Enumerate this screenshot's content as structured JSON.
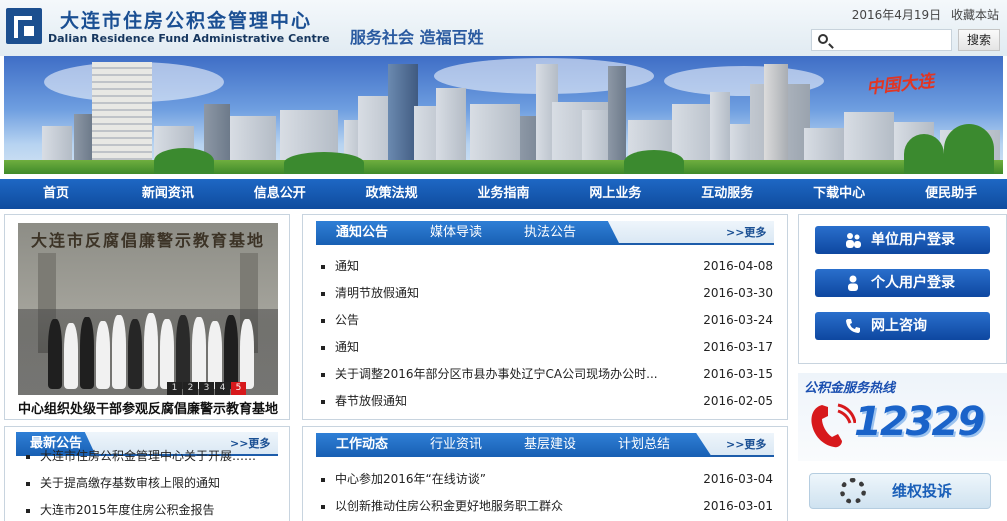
{
  "header": {
    "logo_cn": "大连市住房公积金管理中心",
    "logo_en": "Dalian Residence Fund Administrative Centre",
    "slogan": "服务社会 造福百姓",
    "date": "2016年4月19日",
    "favorite": "收藏本站",
    "search_placeholder": "",
    "search_button": "搜索",
    "search_icon": "search-icon"
  },
  "banner": {
    "corner_text": "中国大连"
  },
  "nav": {
    "items": [
      "首页",
      "新闻资讯",
      "信息公开",
      "政策法规",
      "业务指南",
      "网上业务",
      "互动服务",
      "下载中心",
      "便民助手"
    ]
  },
  "photo": {
    "sign": "大连市反腐倡廉警示教育基地",
    "caption": "中心组织处级干部参观反腐倡廉警示教育基地",
    "pages": [
      "1",
      "2",
      "3",
      "4",
      "5"
    ],
    "active_page": "5"
  },
  "notice": {
    "tabs": [
      "通知公告",
      "媒体导读",
      "执法公告"
    ],
    "more": ">>更多",
    "items": [
      {
        "title": "通知",
        "date": "2016-04-08"
      },
      {
        "title": "清明节放假通知",
        "date": "2016-03-30"
      },
      {
        "title": "公告",
        "date": "2016-03-24"
      },
      {
        "title": "通知",
        "date": "2016-03-17"
      },
      {
        "title": "关于调整2016年部分区市县办事处辽宁CA公司现场办公时...",
        "date": "2016-03-15"
      },
      {
        "title": "春节放假通知",
        "date": "2016-02-05"
      }
    ]
  },
  "latest": {
    "tab": "最新公告",
    "more": ">>更多",
    "items": [
      {
        "title": "大连市住房公积金管理中心关于开展……"
      },
      {
        "title": "关于提高缴存基数审核上限的通知"
      },
      {
        "title": "大连市2015年度住房公积金报告"
      }
    ]
  },
  "work": {
    "tabs": [
      "工作动态",
      "行业资讯",
      "基层建设",
      "计划总结"
    ],
    "more": ">>更多",
    "items": [
      {
        "title": "中心参加2016年“在线访谈”",
        "date": "2016-03-04"
      },
      {
        "title": "以创新推动住房公积金更好地服务职工群众",
        "date": "2016-03-01"
      }
    ]
  },
  "sidebar": {
    "buttons": [
      {
        "label": "单位用户登录",
        "icon": "group-users-icon"
      },
      {
        "label": "个人用户登录",
        "icon": "user-icon"
      },
      {
        "label": "网上咨询",
        "icon": "phone-icon"
      }
    ],
    "hotline_title": "公积金服务热线",
    "hotline_number": "12329",
    "rights_label": "维权投诉"
  },
  "colors": {
    "nav": "#1a5fb8",
    "tab": "#2a78d2",
    "accent": "#d7191c"
  }
}
